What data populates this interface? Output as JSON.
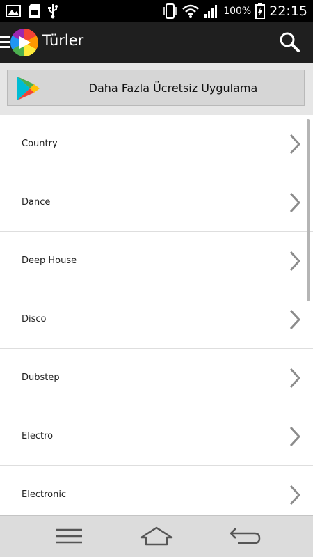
{
  "status_bar": {
    "battery_percent": "100%",
    "time": "22:15",
    "icons": [
      "image-notification-icon",
      "sd-card-icon",
      "usb-icon",
      "vibrate-icon",
      "wifi-icon",
      "signal-icon",
      "battery-charging-icon"
    ]
  },
  "action_bar": {
    "title": "Türler",
    "icons": [
      "menu-icon",
      "app-logo-icon",
      "search-icon"
    ]
  },
  "promo": {
    "label": "Daha Fazla Ücretsiz Uygulama",
    "icon": "play-store-icon"
  },
  "genres": [
    "Country",
    "Dance",
    "Deep House",
    "Disco",
    "Dubstep",
    "Electro",
    "Electronic"
  ],
  "nav_bar": {
    "icons": [
      "menu-icon",
      "home-icon",
      "back-icon"
    ]
  },
  "colors": {
    "status_bar_bg": "#000000",
    "action_bar_bg": "#1f1f1f",
    "promo_bg": "#e6e6e6",
    "list_bg": "#ffffff",
    "nav_bar_bg": "#dcdcdc"
  }
}
